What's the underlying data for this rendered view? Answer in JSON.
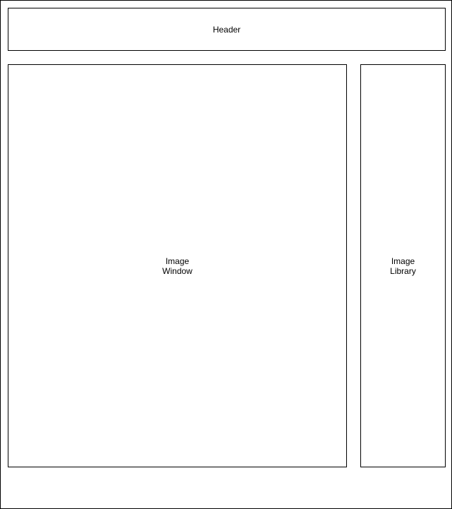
{
  "wireframe": {
    "header": {
      "label": "Header"
    },
    "image_window": {
      "label": "Image\nWindow"
    },
    "image_library": {
      "label": "Image\nLibrary"
    }
  }
}
